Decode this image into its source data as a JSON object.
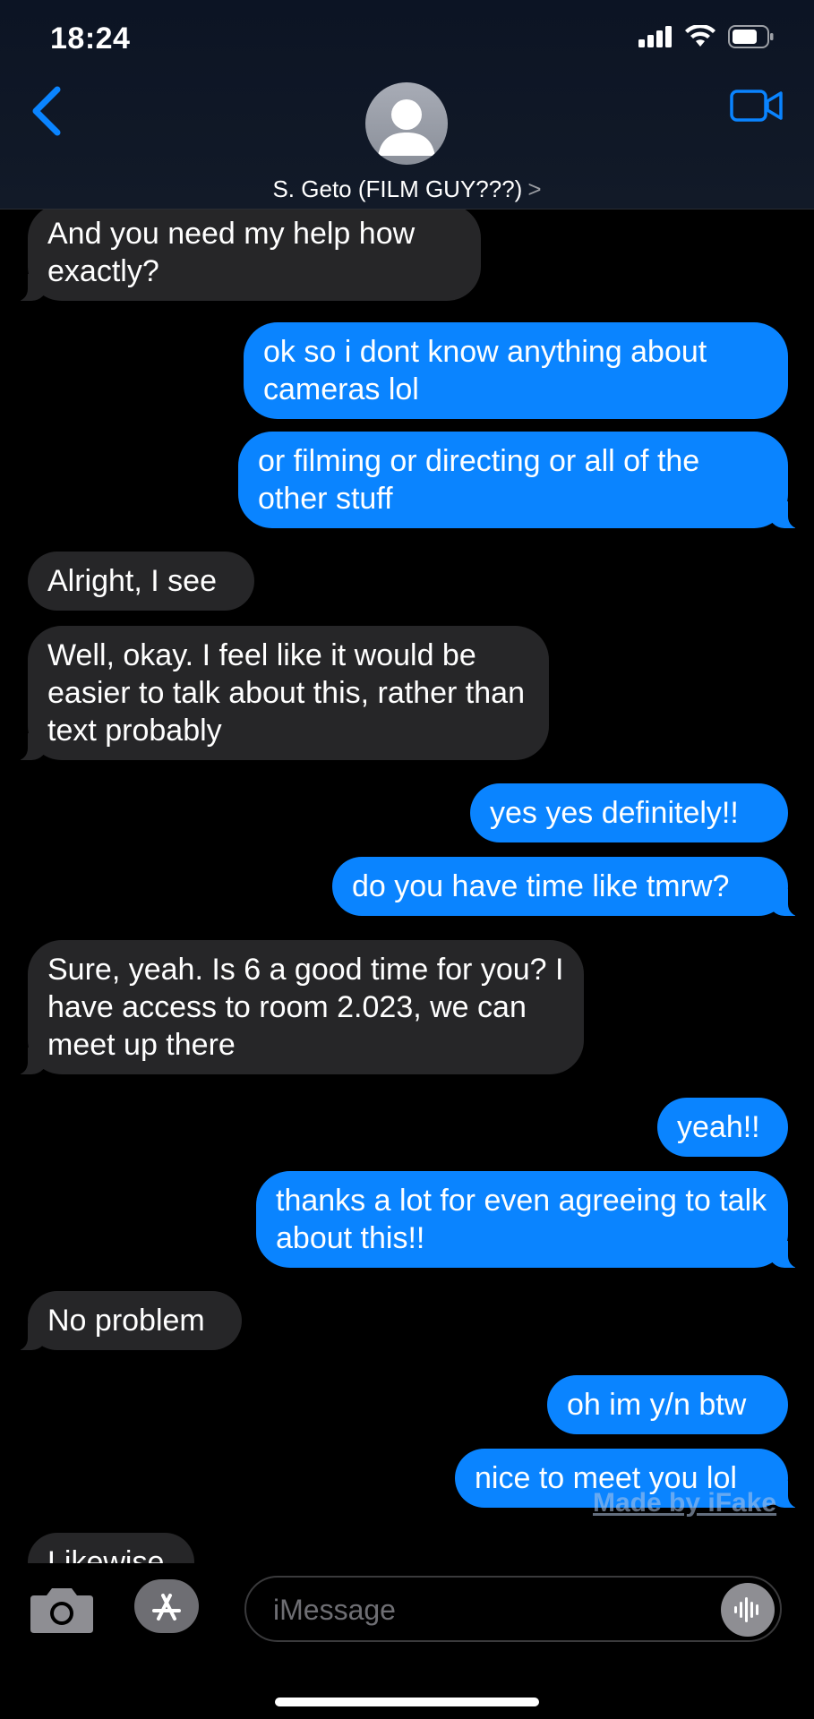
{
  "status_bar": {
    "time": "18:24",
    "icons": [
      "signal-icon",
      "wifi-icon",
      "battery-icon"
    ]
  },
  "header": {
    "contact_name": "S. Geto (FILM GUY???)",
    "chevron": ">",
    "avatar": "person-icon"
  },
  "messages": [
    {
      "from": "them",
      "text": "And you need my help how exactly?"
    },
    {
      "from": "me",
      "text": "ok so i dont know anything about cameras lol"
    },
    {
      "from": "me",
      "text": "or filming or directing or all of the other stuff"
    },
    {
      "from": "them",
      "text": "Alright, I see"
    },
    {
      "from": "them",
      "text": "Well, okay. I feel like it would be easier to talk about this, rather than text probably"
    },
    {
      "from": "me",
      "text": "yes yes definitely!!"
    },
    {
      "from": "me",
      "text": "do you have time like tmrw?"
    },
    {
      "from": "them",
      "text": "Sure, yeah. Is 6 a good time for you? I have access to room 2.023, we can meet up there"
    },
    {
      "from": "me",
      "text": "yeah!!"
    },
    {
      "from": "me",
      "text": "thanks a lot for even agreeing to talk about this!!"
    },
    {
      "from": "them",
      "text": "No problem"
    },
    {
      "from": "me",
      "text": "oh im y/n btw"
    },
    {
      "from": "me",
      "text": "nice to meet you lol"
    },
    {
      "from": "them",
      "text": "Likewise"
    }
  ],
  "watermark": "Made by iFake",
  "compose": {
    "placeholder": "iMessage"
  },
  "colors": {
    "outgoing": "#0a84ff",
    "incoming": "#262628",
    "background": "#000000",
    "accent": "#0a84ff"
  }
}
